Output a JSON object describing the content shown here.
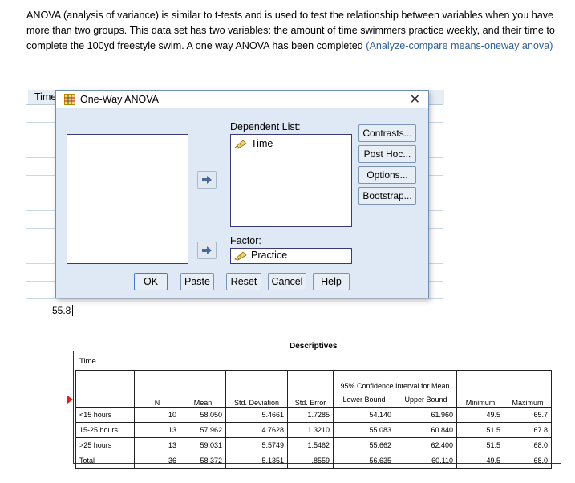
{
  "intro": {
    "text": "ANOVA (analysis of variance) is similar to t-tests and is used to test the relationship between variables when you have more than two groups.  This data set has two variables: the amount of time swimmers practice weekly, and their time to complete the 100yd freestyle swim.  A one way ANOVA has been completed ",
    "link": "(Analyze-compare means-oneway anova)"
  },
  "sheet": {
    "column_header": "Time",
    "cell_value": "55.8"
  },
  "dialog": {
    "title": "One-Way ANOVA",
    "dependent_label": "Dependent List:",
    "dependent_item": "Time",
    "factor_label": "Factor:",
    "factor_item": "Practice",
    "side_buttons": [
      "Contrasts...",
      "Post Hoc...",
      "Options...",
      "Bootstrap..."
    ],
    "bottom_buttons": [
      "OK",
      "Paste",
      "Reset",
      "Cancel",
      "Help"
    ]
  },
  "descriptives": {
    "title": "Descriptives",
    "variable": "Time",
    "ci_header": "95% Confidence Interval for Mean",
    "headers": [
      "N",
      "Mean",
      "Std. Deviation",
      "Std. Error",
      "Lower Bound",
      "Upper Bound",
      "Minimum",
      "Maximum"
    ],
    "rows": [
      [
        "<15 hours",
        "10",
        "58.050",
        "5.4661",
        "1.7285",
        "54.140",
        "61.960",
        "49.5",
        "65.7"
      ],
      [
        "15-25 hours",
        "13",
        "57.962",
        "4.7628",
        "1.3210",
        "55.083",
        "60.840",
        "51.5",
        "67.8"
      ],
      [
        ">25 hours",
        "13",
        "59.031",
        "5.5749",
        "1.5462",
        "55.662",
        "62.400",
        "51.5",
        "68.0"
      ],
      [
        "Total",
        "36",
        "58.372",
        "5.1351",
        ".8559",
        "56.635",
        "60.110",
        "49.5",
        "68.0"
      ]
    ]
  },
  "colors": {
    "accent": "#2e5e9e",
    "dialog_bg": "#dfe9f5",
    "marker": "#dd2222"
  }
}
